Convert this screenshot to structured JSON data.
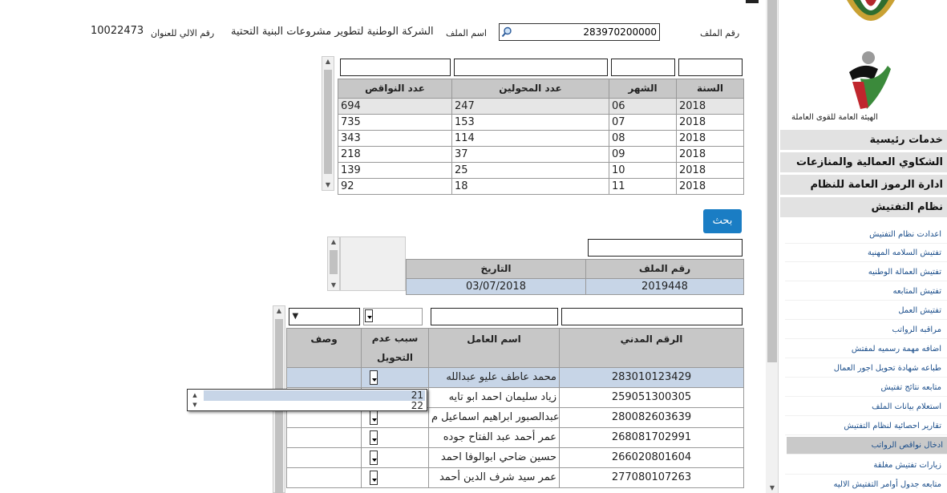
{
  "header": {
    "file_no_label": "رقم الملف",
    "file_no_value": "283970200000",
    "file_name_label": "اسم الملف",
    "file_name_value": "الشركة الوطنية لتطوير مشروعات البنية التحتية",
    "auto_no_label": "رقم الالي للعنوان",
    "auto_no_value": "10022473"
  },
  "stats_table": {
    "columns": [
      "السنة",
      "الشهر",
      "عدد المحولين",
      "عدد النواقص"
    ],
    "rows": [
      [
        "2018",
        "06",
        "247",
        "694"
      ],
      [
        "2018",
        "07",
        "153",
        "735"
      ],
      [
        "2018",
        "08",
        "114",
        "343"
      ],
      [
        "2018",
        "09",
        "37",
        "218"
      ],
      [
        "2018",
        "10",
        "25",
        "139"
      ],
      [
        "2018",
        "11",
        "18",
        "92"
      ]
    ]
  },
  "search_button": "بحث",
  "file_table": {
    "columns": [
      "رقم الملف",
      "التاريخ"
    ],
    "rows": [
      [
        "2019448",
        "03/07/2018"
      ]
    ]
  },
  "workers_table": {
    "columns": [
      "الرقم المدني",
      "اسم العامل",
      "سبب عدم التحويل",
      "وصف"
    ],
    "rows": [
      [
        "283010123429",
        "محمد عاطف عليو عبدالله"
      ],
      [
        "259051300305",
        "زياد سليمان احمد ابو تايه"
      ],
      [
        "280082603639",
        "عبدالصبور ابراهيم اسماعيل م..."
      ],
      [
        "268081702991",
        "عمر أحمد عبد الفتاح جوده"
      ],
      [
        "266020801604",
        "حسين ضاحي ابوالوفا احمد"
      ],
      [
        "277080107263",
        "عمر سيد شرف الدين أحمد"
      ]
    ]
  },
  "dropdown_popup": {
    "options": [
      "21",
      "22"
    ]
  },
  "sidebar": {
    "org_name": "الهيئة العامة للقوى العاملة",
    "sections": [
      "خدمات رئيسية",
      "الشكاوي العمالية والمنازعات",
      "ادارة الرموز العامة للنظام",
      "نظام التفتيش"
    ],
    "items": [
      "اعدادت نظام التفتيش",
      "تفتيش السلامه المهنية",
      "تفتيش العمالة الوطنيه",
      "تفتيش المتابعه",
      "تفتيش العمل",
      "مراقبه الرواتب",
      "اضافه مهمة رسميه لمفتش",
      "طباعه شهادة تحويل اجور العمال",
      "متابعه نتائج تفتيش",
      "استعلام بيانات الملف",
      "تقارير احصائية لنظام التفتيش",
      "ادخال نواقص الرواتب",
      "زيارات تفتيش مغلقة",
      "متابعه جدول أوامر التفتيش الاليه"
    ]
  }
}
